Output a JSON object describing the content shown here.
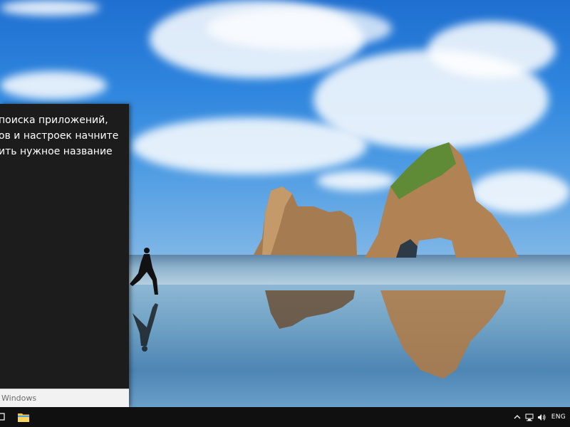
{
  "start_flyout": {
    "message_lines": [
      "поиска приложений,",
      "ов и настроек начните",
      "ить нужное название"
    ],
    "search_placeholder": "Windows"
  },
  "taskbar": {
    "pinned": [
      {
        "name": "task-view",
        "icon": "task-view-icon"
      },
      {
        "name": "file-explorer",
        "icon": "folder-icon"
      }
    ],
    "tray": {
      "icons": [
        "chevron-up-icon",
        "network-icon",
        "volume-icon"
      ],
      "language": "ENG"
    }
  },
  "colors": {
    "taskbar_bg": "#101010",
    "flyout_bg": "#1c1c1c",
    "searchbox_bg": "#f2f2f2",
    "explorer_yellow": "#f7c23c"
  }
}
